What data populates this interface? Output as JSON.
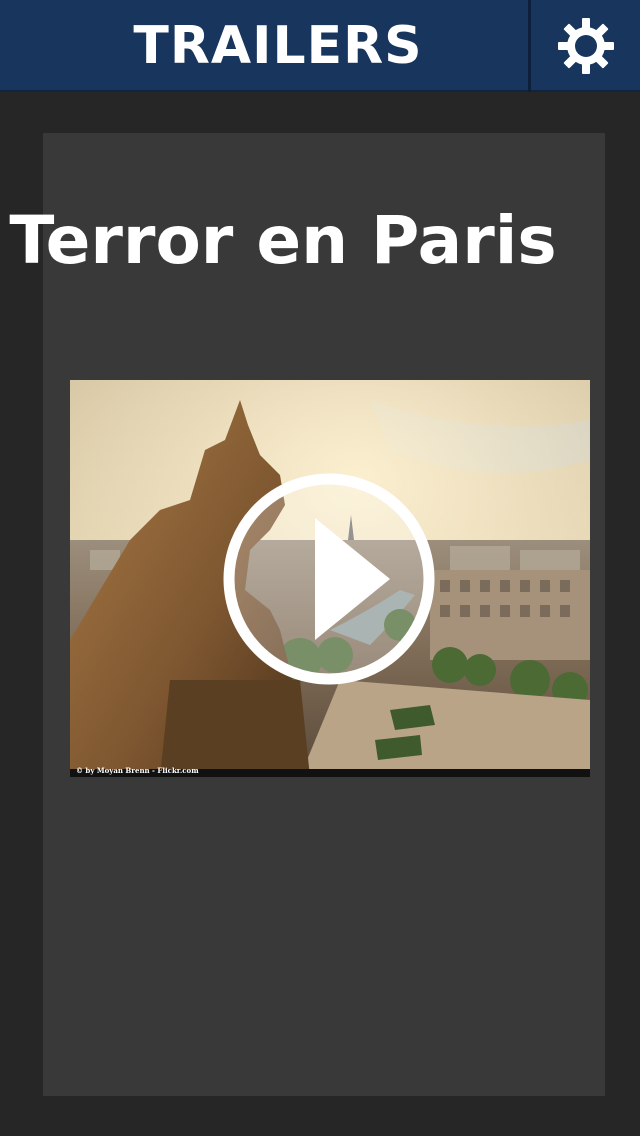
{
  "header": {
    "title": "TRAILERS",
    "settings_icon": "gear-icon",
    "background_color": "#17355d"
  },
  "trailer": {
    "title": "Terror en Paris",
    "thumbnail_credit": "© by Moyan Brenn - Flickr.com",
    "play_icon": "play-icon"
  }
}
